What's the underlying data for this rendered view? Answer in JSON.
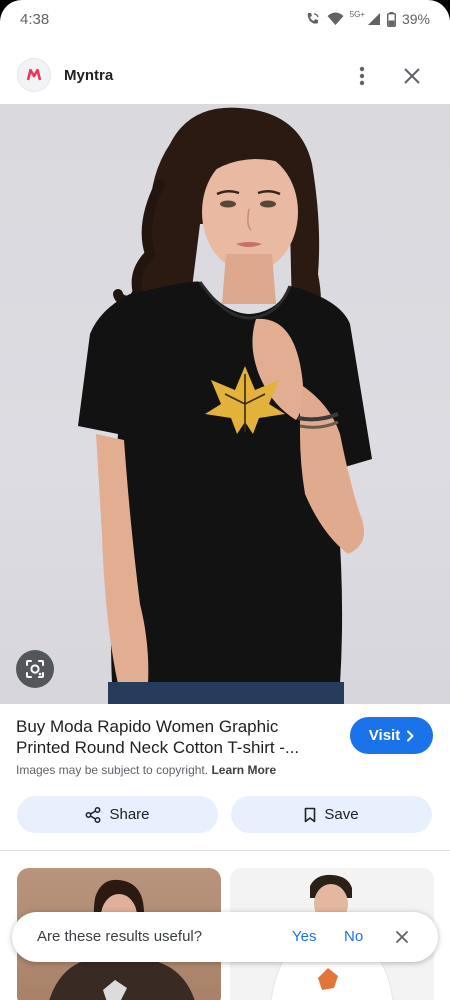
{
  "status_bar": {
    "time": "4:38",
    "network": "5G+",
    "battery": "39%"
  },
  "header": {
    "site_name": "Myntra",
    "logo_letter": "M",
    "logo_color": "#e8395b"
  },
  "product": {
    "title_line1": "Buy Moda Rapido Women Graphic",
    "title_line2": "Printed Round Neck Cotton T-shirt -...",
    "visit_label": "Visit",
    "copyright_text": "Images may be subject to copyright.",
    "learn_more": "Learn More"
  },
  "actions": {
    "share_label": "Share",
    "save_label": "Save"
  },
  "feedback": {
    "question": "Are these results useful?",
    "yes": "Yes",
    "no": "No"
  },
  "colors": {
    "accent": "#1a73e8",
    "action_bg": "#e8f0fe",
    "tshirt": "#111111",
    "leaf_print": "#e2b23a"
  }
}
